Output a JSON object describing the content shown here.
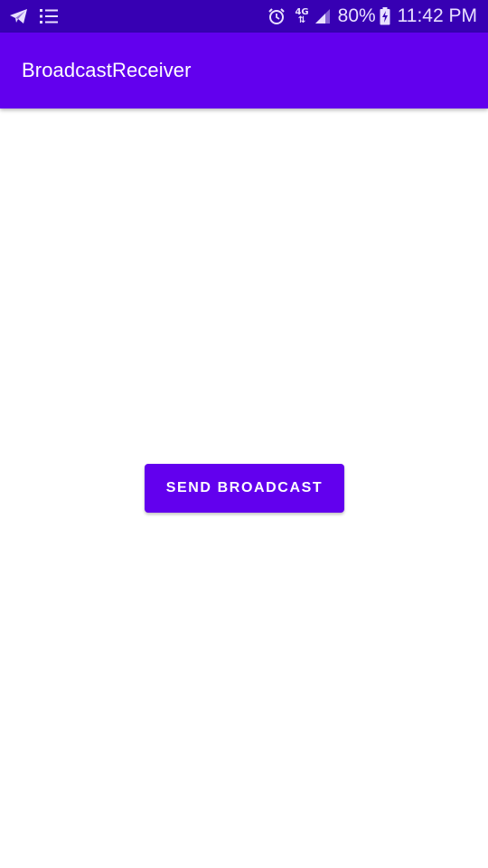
{
  "status_bar": {
    "left_icons": [
      "telegram-icon",
      "checklist-icon"
    ],
    "right_icons": [
      "alarm-icon",
      "network-4g-icon",
      "signal-icon",
      "battery-charging-icon"
    ],
    "network_label": "4G",
    "battery_percent": "80%",
    "time": "11:42 PM"
  },
  "app_bar": {
    "title": "BroadcastReceiver"
  },
  "main": {
    "send_button_label": "SEND BROADCAST"
  },
  "colors": {
    "status_bar": "#3700b3",
    "primary": "#6200ee",
    "background": "#ffffff",
    "on_primary": "#ffffff"
  }
}
